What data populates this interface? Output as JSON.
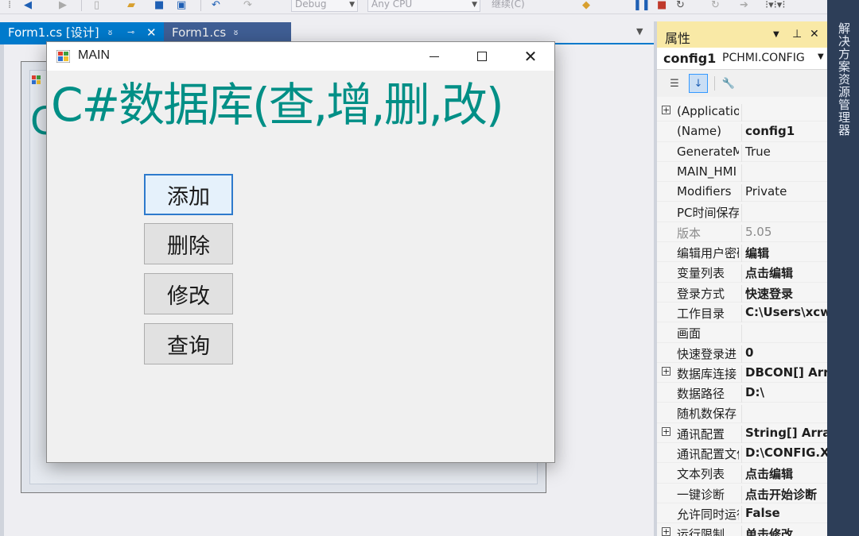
{
  "toolbar": {
    "config_combo": "Debug",
    "platform_combo": "Any CPU",
    "start_label": "继续(C)"
  },
  "tabs": [
    {
      "label": "Form1.cs [设计]",
      "pin": "ᴕ",
      "pushpin": "⊸",
      "close": "✕"
    },
    {
      "label": "Form1.cs",
      "pin": "ᴕ"
    }
  ],
  "main_window": {
    "title": "MAIN",
    "heading": "C#数据库(查,增,删,改)",
    "buttons": [
      "添加",
      "删除",
      "修改",
      "查询"
    ]
  },
  "ghost_form": {
    "heading_fragment": "C"
  },
  "properties": {
    "title": "属性",
    "object_name": "config1",
    "object_type": "PCHMI.CONFIG",
    "rows": [
      {
        "name": "(ApplicationSettings)",
        "value": "",
        "expand": true
      },
      {
        "name": "(Name)",
        "value": "config1",
        "bold": true
      },
      {
        "name": "GenerateMember",
        "value": "True"
      },
      {
        "name": "MAIN_HMI",
        "value": ""
      },
      {
        "name": "Modifiers",
        "value": "Private"
      },
      {
        "name": "PC时间保存",
        "value": ""
      },
      {
        "name": "版本",
        "value": "5.05",
        "grey": true
      },
      {
        "name": "编辑用户密码",
        "value": "编辑",
        "bold": true
      },
      {
        "name": "变量列表",
        "value": "点击编辑",
        "bold": true
      },
      {
        "name": "登录方式",
        "value": "快速登录",
        "bold": true
      },
      {
        "name": "工作目录",
        "value": "C:\\Users\\xcw",
        "bold": true
      },
      {
        "name": "画面",
        "value": ""
      },
      {
        "name": "快速登录进",
        "value": "0",
        "bold": true
      },
      {
        "name": "数据库连接",
        "value": "DBCON[] Array",
        "bold": true,
        "expand": true
      },
      {
        "name": "数据路径",
        "value": "D:\\",
        "bold": true
      },
      {
        "name": "随机数保存",
        "value": ""
      },
      {
        "name": "通讯配置",
        "value": "String[] Array",
        "bold": true,
        "expand": true
      },
      {
        "name": "通讯配置文件",
        "value": "D:\\CONFIG.XML",
        "bold": true
      },
      {
        "name": "文本列表",
        "value": "点击编辑",
        "bold": true
      },
      {
        "name": "一键诊断",
        "value": "点击开始诊断",
        "bold": true
      },
      {
        "name": "允许同时运行",
        "value": "False",
        "bold": true
      },
      {
        "name": "运行限制",
        "value": "单击修改",
        "bold": true,
        "expand": true
      }
    ]
  },
  "side_tab": {
    "label": "解决方案资源管理器"
  }
}
